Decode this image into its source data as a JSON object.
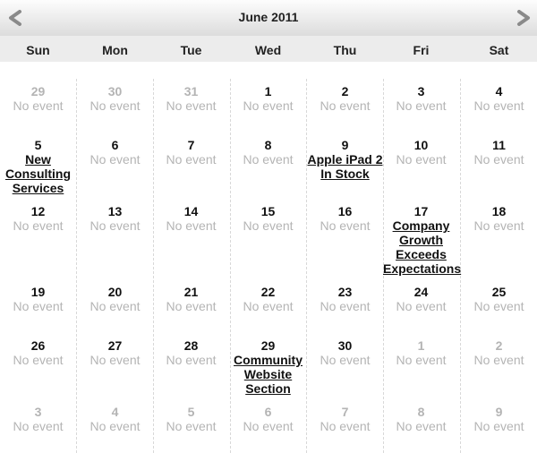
{
  "calendar": {
    "title": "June 2011",
    "weekdays": [
      "Sun",
      "Mon",
      "Tue",
      "Wed",
      "Thu",
      "Fri",
      "Sat"
    ],
    "no_event_label": "No event",
    "weeks": [
      [
        {
          "day": "29",
          "other": true
        },
        {
          "day": "30",
          "other": true
        },
        {
          "day": "31",
          "other": true
        },
        {
          "day": "1"
        },
        {
          "day": "2"
        },
        {
          "day": "3"
        },
        {
          "day": "4"
        }
      ],
      [
        {
          "day": "5",
          "event": [
            "New",
            "Consulting",
            "Services"
          ]
        },
        {
          "day": "6"
        },
        {
          "day": "7"
        },
        {
          "day": "8"
        },
        {
          "day": "9",
          "event": [
            "Apple iPad 2",
            "In Stock"
          ]
        },
        {
          "day": "10"
        },
        {
          "day": "11"
        }
      ],
      [
        {
          "day": "12"
        },
        {
          "day": "13"
        },
        {
          "day": "14"
        },
        {
          "day": "15"
        },
        {
          "day": "16"
        },
        {
          "day": "17",
          "event": [
            "Company",
            "Growth",
            "Exceeds",
            "Expectations"
          ]
        },
        {
          "day": "18"
        }
      ],
      [
        {
          "day": "19"
        },
        {
          "day": "20"
        },
        {
          "day": "21"
        },
        {
          "day": "22"
        },
        {
          "day": "23"
        },
        {
          "day": "24"
        },
        {
          "day": "25"
        }
      ],
      [
        {
          "day": "26"
        },
        {
          "day": "27"
        },
        {
          "day": "28"
        },
        {
          "day": "29",
          "event": [
            "Community",
            "Website",
            "Section"
          ]
        },
        {
          "day": "30"
        },
        {
          "day": "1",
          "other": true
        },
        {
          "day": "2",
          "other": true
        }
      ],
      [
        {
          "day": "3",
          "other": true
        },
        {
          "day": "4",
          "other": true
        },
        {
          "day": "5",
          "other": true
        },
        {
          "day": "6",
          "other": true
        },
        {
          "day": "7",
          "other": true
        },
        {
          "day": "8",
          "other": true
        },
        {
          "day": "9",
          "other": true
        }
      ]
    ]
  },
  "icons": {
    "prev": "chevron-left-icon",
    "next": "chevron-right-icon"
  },
  "colors": {
    "muted": "#b4b4b4",
    "text": "#111111",
    "header_top": "#fdfdfd",
    "header_bottom": "#dcdcdc",
    "weekday_bar": "#ececec"
  }
}
